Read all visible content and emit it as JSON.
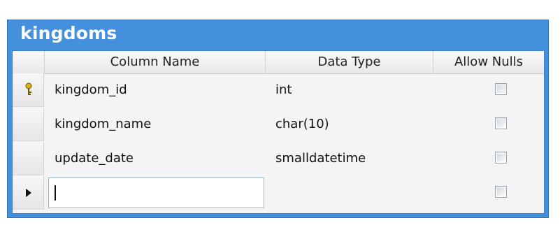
{
  "table": {
    "title": "kingdoms",
    "columns": [
      "Column Name",
      "Data Type",
      "Allow Nulls"
    ],
    "rows": [
      {
        "name": "kingdom_id",
        "type": "int",
        "allow_nulls": false,
        "indicator": "key-icon"
      },
      {
        "name": "kingdom_name",
        "type": "char(10)",
        "allow_nulls": false,
        "indicator": ""
      },
      {
        "name": "update_date",
        "type": "smalldatetime",
        "allow_nulls": false,
        "indicator": ""
      }
    ],
    "new_row": {
      "name": "",
      "type": "",
      "allow_nulls": false,
      "indicator": "current-row-arrow-icon"
    }
  },
  "colors": {
    "window_blue": "#4590dd",
    "grid_background": "#f4f4f4",
    "header_text": "#222222"
  }
}
